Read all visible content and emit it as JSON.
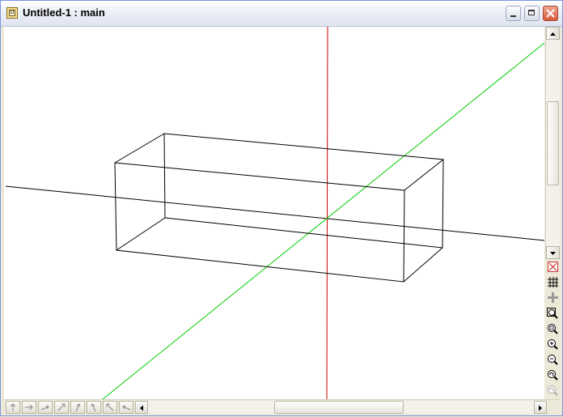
{
  "window": {
    "title": "Untitled-1 : main",
    "app_icon_letter": "D"
  },
  "colors": {
    "x_axis": "#000000",
    "y_axis": "#00cc00",
    "z_axis": "#cc0000",
    "box": "#000000"
  },
  "view_tools": [
    "delete-view-icon",
    "grid-icon",
    "crosshair-icon",
    "zoom-extents-icon",
    "zoom-window-icon",
    "zoom-in-icon",
    "zoom-out-icon",
    "zoom-previous-icon",
    "zoom-redo-icon"
  ],
  "nav_buttons": [
    "view-up-icon",
    "view-right-icon",
    "view-up-right-icon",
    "view-ne-icon",
    "view-nne-icon",
    "view-nw-icon",
    "view-back-nw-icon",
    "view-back-icon"
  ]
}
